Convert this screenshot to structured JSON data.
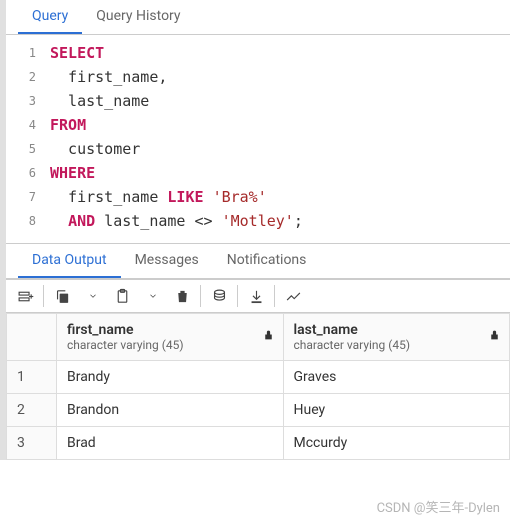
{
  "top_tabs": {
    "query": "Query",
    "history": "Query History"
  },
  "sql": {
    "lines": [
      "1",
      "2",
      "3",
      "4",
      "5",
      "6",
      "7",
      "8"
    ],
    "t1a": "SELECT",
    "t2": "  first_name,",
    "t3": "  last_name",
    "t4a": "FROM",
    "t5": "  customer",
    "t6a": "WHERE",
    "t7a": "  first_name ",
    "t7b": "LIKE",
    "t7c": " ",
    "t7d": "'Bra%'",
    "t8a": "  ",
    "t8b": "AND",
    "t8c": " last_name <> ",
    "t8d": "'Motley'",
    "t8e": ";"
  },
  "out_tabs": {
    "data": "Data Output",
    "messages": "Messages",
    "notifications": "Notifications"
  },
  "columns": [
    {
      "name": "first_name",
      "type": "character varying (45)"
    },
    {
      "name": "last_name",
      "type": "character varying (45)"
    }
  ],
  "rows": [
    {
      "n": "1",
      "c0": "Brandy",
      "c1": "Graves"
    },
    {
      "n": "2",
      "c0": "Brandon",
      "c1": "Huey"
    },
    {
      "n": "3",
      "c0": "Brad",
      "c1": "Mccurdy"
    }
  ],
  "watermark": "CSDN @笑三年-Dylen"
}
